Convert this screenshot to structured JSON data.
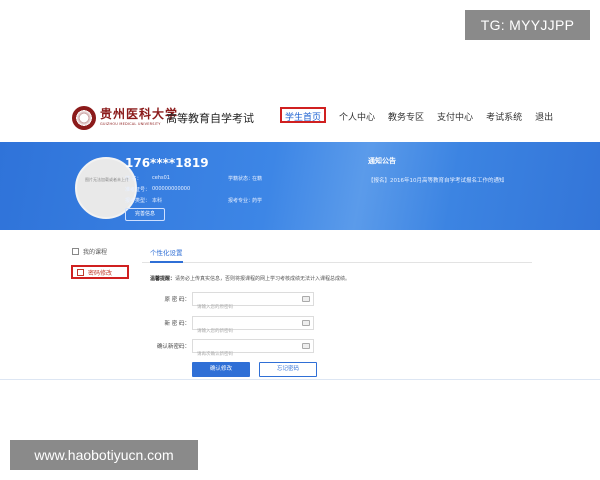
{
  "watermark": {
    "top": "TG: MYYJJPP",
    "bottom": "www.haobotiyucn.com"
  },
  "header": {
    "logo_cn": "贵州医科大学",
    "logo_en": "GUIZHOU MEDICAL UNIVERSITY",
    "site_title": "高等教育自学考试",
    "nav": [
      {
        "label": "学生首页",
        "active": true
      },
      {
        "label": "个人中心"
      },
      {
        "label": "教务专区"
      },
      {
        "label": "支付中心"
      },
      {
        "label": "考试系统"
      },
      {
        "label": "退出"
      }
    ]
  },
  "profile": {
    "avatar_text": "图片无法加载或者未上传",
    "phone": "176****1819",
    "name_label": "姓    名：",
    "name_value": "cehs01",
    "status_label": "学籍状态：",
    "status_value": "在籍",
    "exam_id_label": "准考证号：",
    "exam_id_value": "000000000000",
    "type_label": "报考类型：",
    "type_value": "本科",
    "major_label": "报考专业：",
    "major_value": "药学",
    "detail_button": "完善信息"
  },
  "notice": {
    "title": "通知公告",
    "items": [
      "【报名】2016年10月高等教育自学考试报名工作的通知"
    ]
  },
  "sidebar": {
    "items": [
      {
        "label": "我的课程"
      },
      {
        "label": "密码修改",
        "active": true
      }
    ]
  },
  "main": {
    "tab": "个性化设置",
    "tip_label": "温馨提醒：",
    "tip_text": "请务必上传真实信息，否则将报课程的网上学习考核成绩无法计入课程总成绩。",
    "fields": [
      {
        "label": "原 密 码：",
        "placeholder": "请输入您的原密码"
      },
      {
        "label": "新 密 码：",
        "placeholder": "请输入您的新密码"
      },
      {
        "label": "确认新密码：",
        "placeholder": "请再次确认新密码"
      }
    ],
    "confirm_button": "确认修改",
    "forgot_button": "忘记密码"
  },
  "colors": {
    "primary": "#2f6fd6",
    "highlight": "#d02020",
    "brand": "#8b1a1a"
  }
}
